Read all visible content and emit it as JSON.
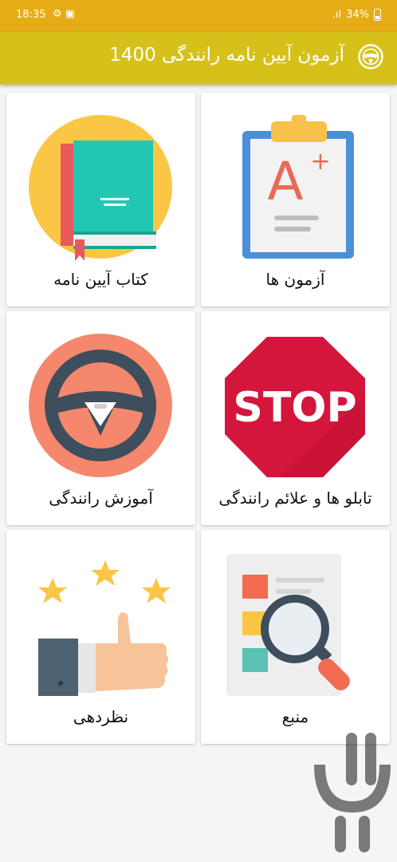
{
  "status_bar": {
    "time": "18:35",
    "left_icons": "⚙ ▣",
    "signal": ".ıl",
    "battery": "34%"
  },
  "app_bar": {
    "title": "آزمون آیین نامه رانندگی 1400",
    "icon": "steering-wheel-icon"
  },
  "menu": {
    "items": [
      {
        "label": "آزمون ها",
        "icon": "clipboard-grade-icon"
      },
      {
        "label": "کتاب آیین نامه",
        "icon": "book-icon"
      },
      {
        "label": "تابلو ها و علائم رانندگی",
        "icon": "stop-sign-icon"
      },
      {
        "label": "آموزش رانندگی",
        "icon": "steering-wheel-icon"
      },
      {
        "label": "منبع",
        "icon": "magnifier-document-icon"
      },
      {
        "label": "نظردهی",
        "icon": "thumbs-up-stars-icon"
      }
    ]
  },
  "stop_sign_text": "STOP",
  "grade_text": "A+",
  "colors": {
    "status_bar": "#e6ac15",
    "app_bar": "#d6c11b",
    "stop_red": "#d4163c",
    "wheel_bg": "#f5876c",
    "book_bg": "#fbc645"
  }
}
